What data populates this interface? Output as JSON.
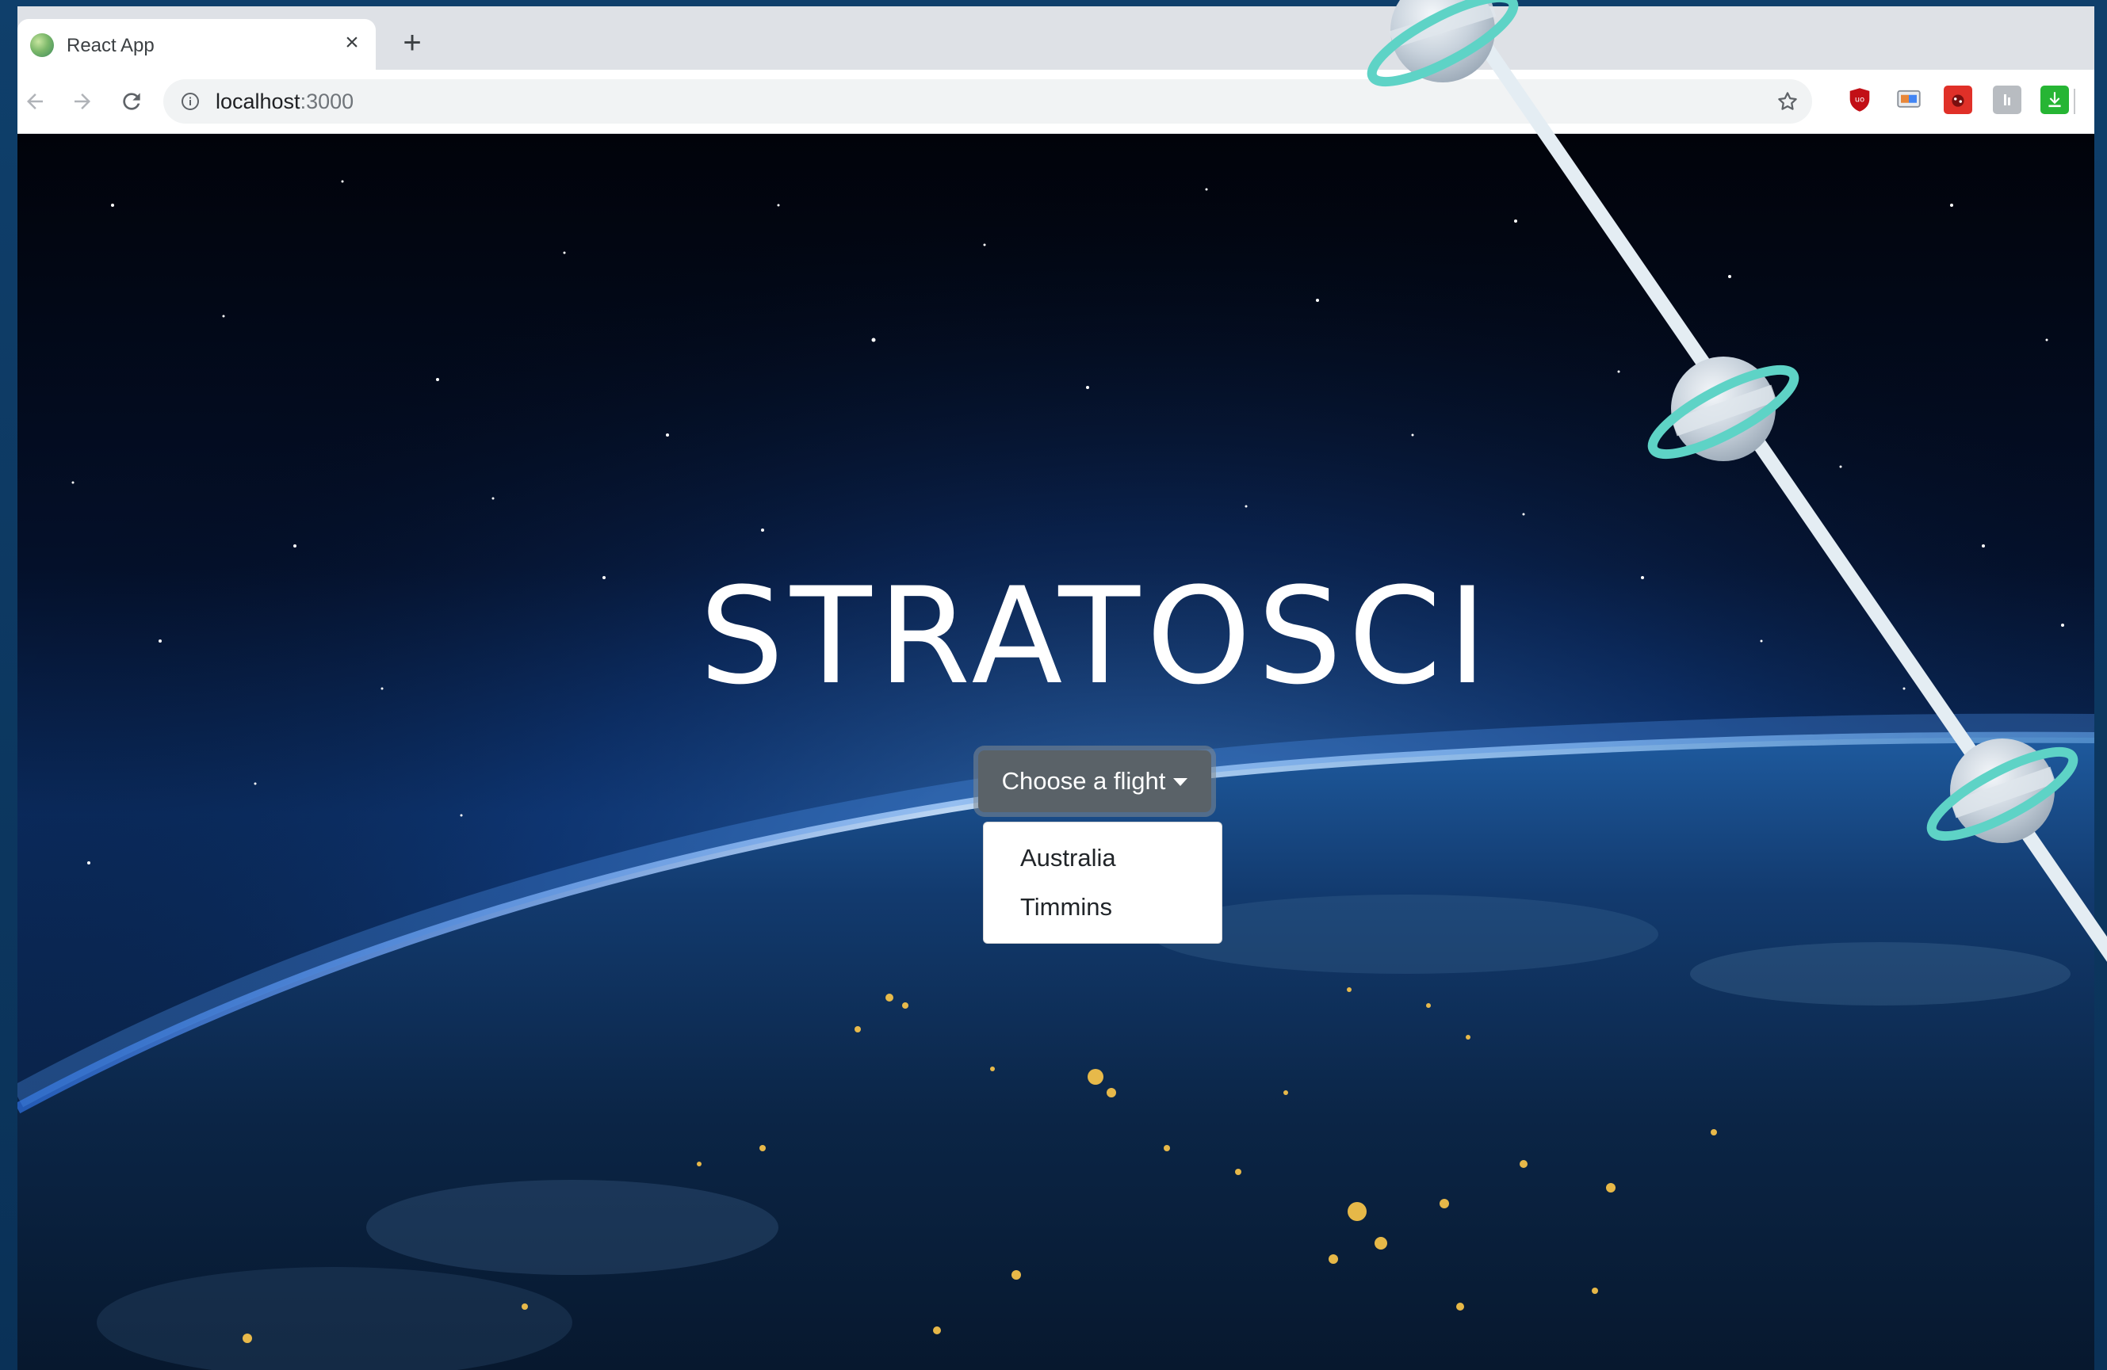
{
  "browser": {
    "tab": {
      "title": "React App",
      "close_glyph": "×",
      "favicon": "react-globe-icon"
    },
    "new_tab_glyph": "+",
    "address_bar": {
      "host": "localhost",
      "port": ":3000"
    },
    "extensions": [
      {
        "name": "ublock-icon",
        "color": "#c20f16"
      },
      {
        "name": "cast-icon",
        "color": "#e8873a"
      },
      {
        "name": "ladybug-icon",
        "color": "#e03028"
      },
      {
        "name": "gray-extension-icon",
        "color": "#a8adb2"
      },
      {
        "name": "download-icon",
        "color": "#26b534"
      }
    ]
  },
  "page": {
    "title": "STRATOSCI",
    "dropdown": {
      "button_label": "Choose a flight",
      "options": [
        "Australia",
        "Timmins"
      ]
    },
    "colors": {
      "button_bg": "#5a6268",
      "planet_ring": "#5ed3c6",
      "string": "#e4edf3"
    }
  }
}
